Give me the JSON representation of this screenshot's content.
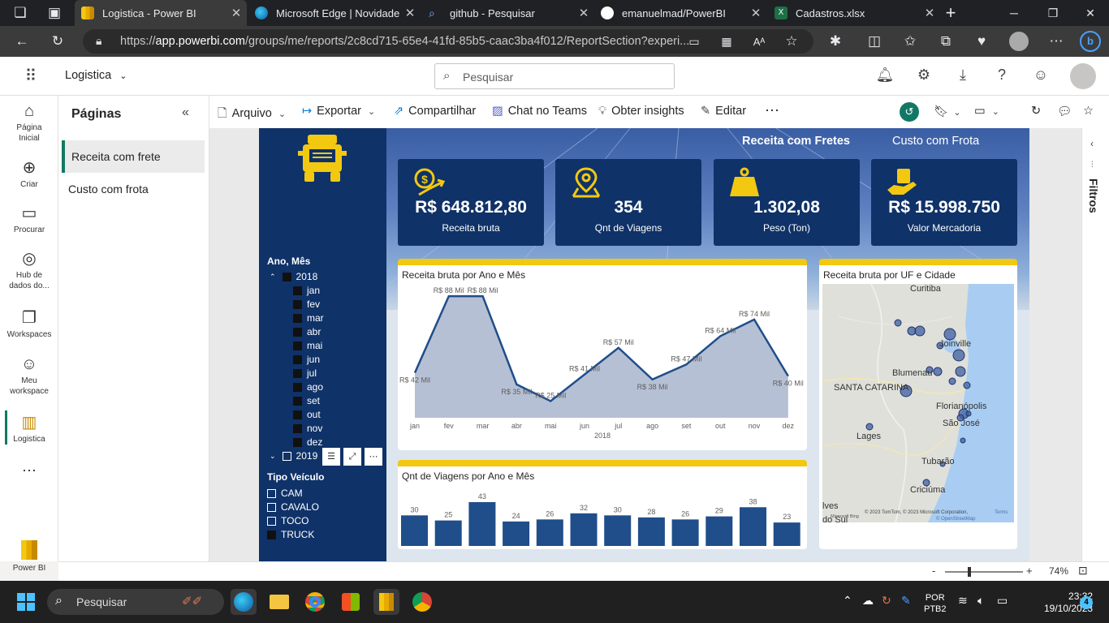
{
  "browser": {
    "tabs": [
      {
        "title": "Logistica - Power BI",
        "active": true
      },
      {
        "title": "Microsoft Edge | Novidades",
        "active": false
      },
      {
        "title": "github - Pesquisar",
        "active": false
      },
      {
        "title": "emanuelmad/PowerBI",
        "active": false
      },
      {
        "title": "Cadastros.xlsx",
        "active": false
      }
    ],
    "url_prefix": "https://",
    "url_host": "app.powerbi.com",
    "url_path": "/groups/me/reports/2c8cd715-65e4-41fd-85b5-caac3ba4f012/ReportSection?experi..."
  },
  "header": {
    "workspace": "Logistica",
    "search_placeholder": "Pesquisar"
  },
  "left_nav": [
    {
      "label": "Página Inicial",
      "icon": "home-icon",
      "glyph": "⌂"
    },
    {
      "label": "Criar",
      "icon": "create-icon",
      "glyph": "⊕"
    },
    {
      "label": "Procurar",
      "icon": "folder-icon",
      "glyph": "▭"
    },
    {
      "label": "Hub de dados do...",
      "icon": "data-hub-icon",
      "glyph": "◎"
    },
    {
      "label": "Workspaces",
      "icon": "workspaces-icon",
      "glyph": "❐"
    },
    {
      "label": "Meu workspace",
      "icon": "my-workspace-icon",
      "glyph": "☺"
    },
    {
      "label": "Logistica",
      "icon": "report-icon",
      "glyph": "▥"
    }
  ],
  "left_nav_footer": "Power BI",
  "pages": {
    "title": "Páginas",
    "items": [
      "Receita com frete",
      "Custo com frota"
    ]
  },
  "toolbar": {
    "arquivo": "Arquivo",
    "exportar": "Exportar",
    "compartilhar": "Compartilhar",
    "chat": "Chat no Teams",
    "insights": "Obter insights",
    "editar": "Editar"
  },
  "report": {
    "nav_active": "Receita com Fretes",
    "nav_other": "Custo com Frota",
    "kpis": [
      {
        "value": "R$ 648.812,80",
        "label": "Receita bruta",
        "icon": "money-growth-icon"
      },
      {
        "value": "354",
        "label": "Qnt de Viagens",
        "icon": "map-pin-icon"
      },
      {
        "value": "1.302,08",
        "label": "Peso (Ton)",
        "icon": "weight-icon"
      },
      {
        "value": "R$ 15.998.750",
        "label": "Valor Mercadoria",
        "icon": "hand-money-icon"
      }
    ],
    "slicer_ano_mes": {
      "title": "Ano, Mês",
      "year1": "2018",
      "months": [
        "jan",
        "fev",
        "mar",
        "abr",
        "mai",
        "jun",
        "jul",
        "ago",
        "set",
        "out",
        "nov",
        "dez"
      ],
      "year2": "2019"
    },
    "slicer_tipo": {
      "title": "Tipo Veículo",
      "items": [
        {
          "label": "CAM",
          "checked": false
        },
        {
          "label": "CAVALO",
          "checked": false
        },
        {
          "label": "TOCO",
          "checked": false
        },
        {
          "label": "TRUCK",
          "checked": true
        }
      ]
    },
    "map": {
      "title": "Receita bruta por UF e Cidade",
      "cities": [
        "Curitiba",
        "Joinville",
        "Blumenau",
        "SANTA CATARINA",
        "Florianópolis",
        "São José",
        "Lages",
        "Tubarão",
        "Criciúma",
        "lves",
        "do Sul"
      ],
      "attribution": "© 2023 TomTom, © 2023 Microsoft Corporation,",
      "terms": "Terms",
      "osm": "© OpenStreetMap",
      "bing": "Microsoft Bing"
    }
  },
  "chart_data": [
    {
      "type": "area",
      "title": "Receita bruta por Ano e Mês",
      "xlabel": "2018",
      "categories": [
        "jan",
        "fev",
        "mar",
        "abr",
        "mai",
        "jun",
        "jul",
        "ago",
        "set",
        "out",
        "nov",
        "dez"
      ],
      "values": [
        42,
        88,
        88,
        35,
        25,
        41,
        57,
        38,
        47,
        64,
        74,
        40
      ],
      "labels": [
        "R$ 42 Mil",
        "R$ 88 Mil",
        "R$ 88 Mil",
        "R$ 35 Mil",
        "R$ 25 Mil",
        "R$ 41 Mil",
        "R$ 57 Mil",
        "R$ 38 Mil",
        "R$ 47 Mil",
        "R$ 64 Mil",
        "R$ 74 Mil",
        "R$ 40 Mil"
      ],
      "colors": {
        "fill": "#a9b5cc",
        "line": "#1f4e8a"
      }
    },
    {
      "type": "bar",
      "title": "Qnt de Viagens por Ano e Mês",
      "values": [
        30,
        25,
        43,
        24,
        26,
        32,
        30,
        28,
        26,
        29,
        38,
        23
      ],
      "colors": {
        "bar": "#1f4e8a"
      }
    }
  ],
  "status": {
    "zoom": "74%",
    "minus": "-",
    "plus": "+"
  },
  "filters_label": "Filtros",
  "taskbar": {
    "search": "Pesquisar",
    "lang1": "POR",
    "lang2": "PTB2",
    "time": "23:32",
    "date": "19/10/2023",
    "notif": "4"
  }
}
